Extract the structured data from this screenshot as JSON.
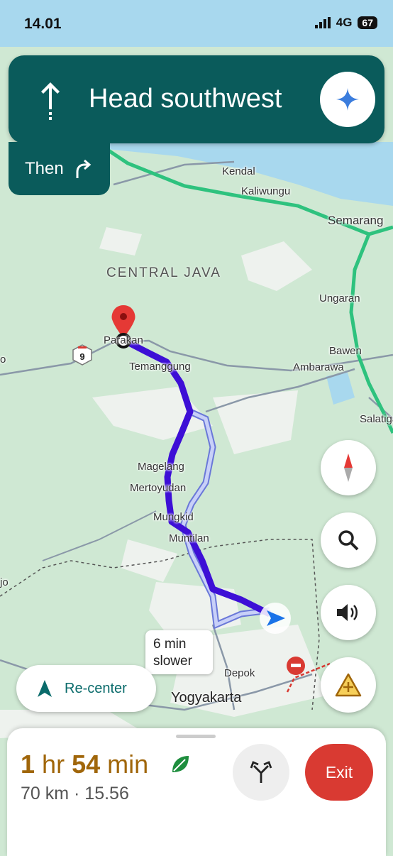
{
  "status_bar": {
    "time": "14.01",
    "network": "4G",
    "battery": "67"
  },
  "navigation": {
    "instruction": "Head southwest",
    "then_label": "Then"
  },
  "map": {
    "region_label": "CENTRAL JAVA",
    "places": [
      "Kendal",
      "Kaliwungu",
      "Semarang",
      "Ungaran",
      "Bawen",
      "Ambarawa",
      "Salatiga",
      "Parakan",
      "Temanggung",
      "Magelang",
      "Mertoyudan",
      "Mungkid",
      "Muntilan",
      "Depok",
      "Yogyakarta"
    ],
    "partial_left": [
      "o",
      "jo"
    ],
    "road_shield": "9",
    "route_callout": "6 min slower"
  },
  "controls": {
    "recenter_label": "Re-center"
  },
  "trip": {
    "eta_hours": "1",
    "eta_hours_unit": "hr",
    "eta_minutes": "54",
    "eta_minutes_unit": "min",
    "distance_and_arrival": "70 km · 15.56",
    "exit_label": "Exit"
  },
  "colors": {
    "banner": "#0a5b5b",
    "route": "#3d0fd6",
    "alt_route": "#a8b4f2",
    "highway": "#2ec27e",
    "exit": "#d93a32",
    "eta": "#a0660a"
  }
}
